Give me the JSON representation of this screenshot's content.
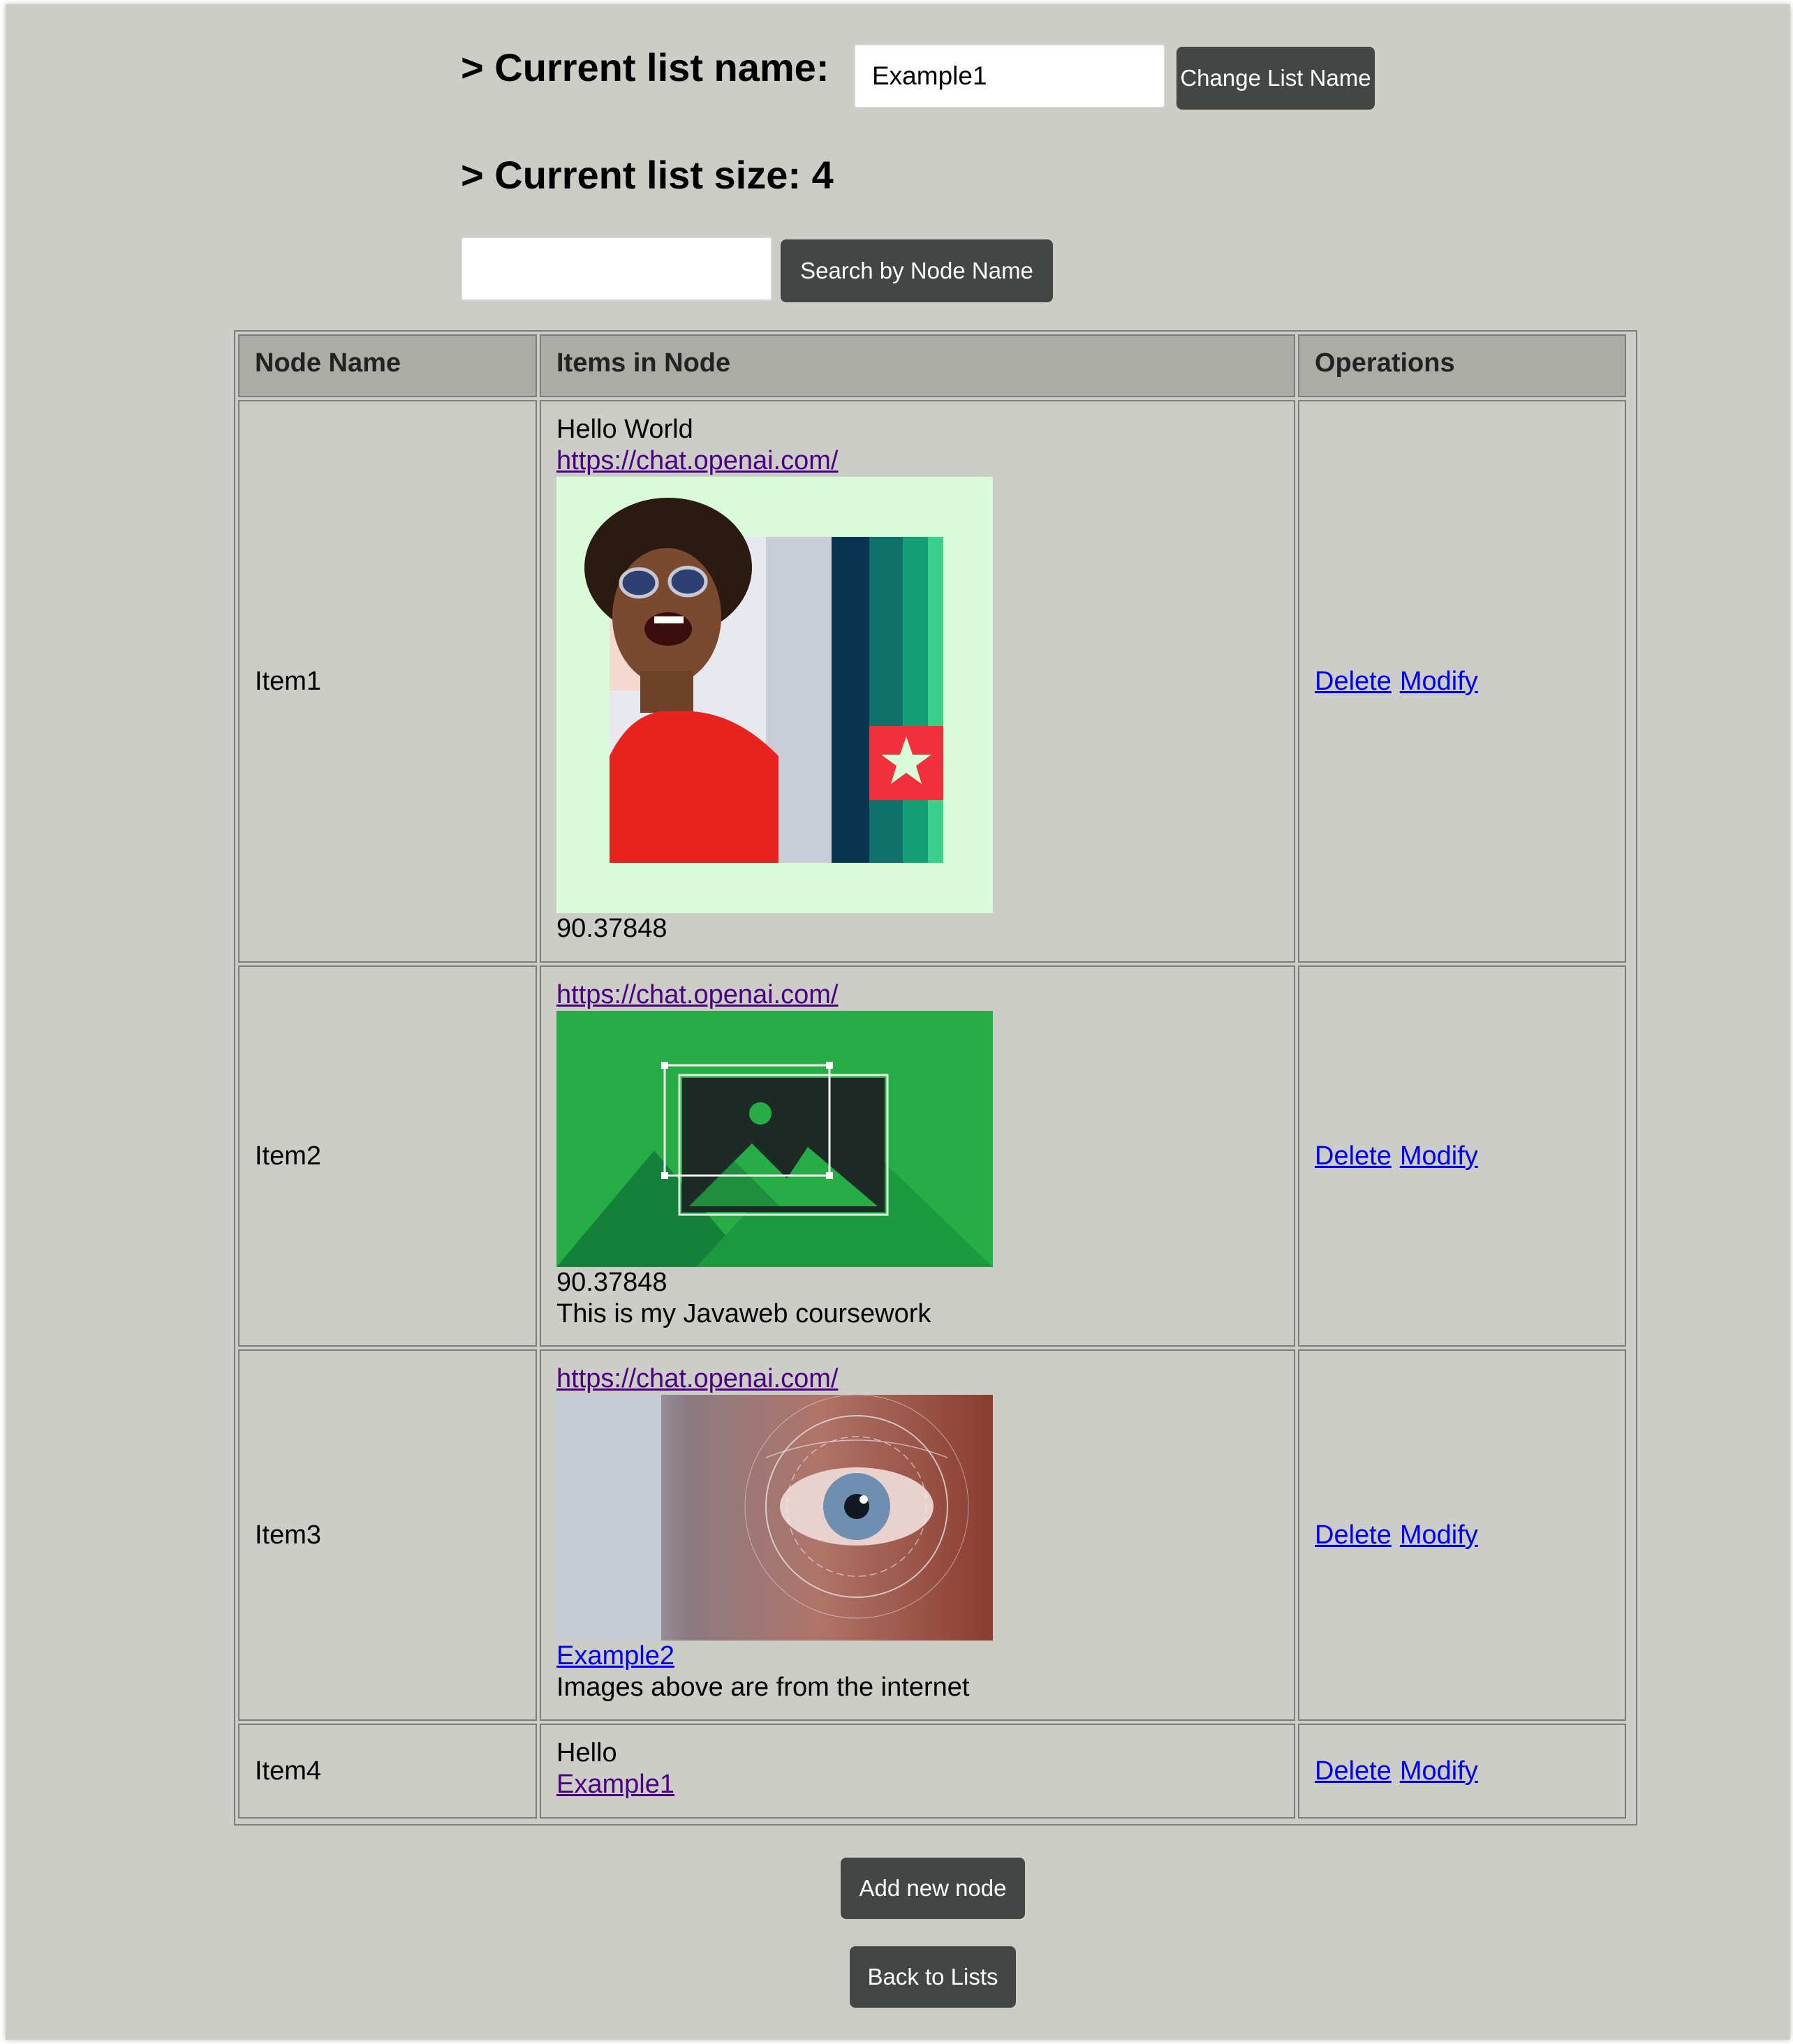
{
  "header": {
    "list_name_label": "> Current list name:",
    "list_name_value": "Example1",
    "change_name_button": "Change List Name",
    "list_size_label": "> Current list size: 4",
    "search_value": "",
    "search_button": "Search by Node Name"
  },
  "table": {
    "columns": [
      "Node Name",
      "Items in Node",
      "Operations"
    ],
    "rows": [
      {
        "name": "Item1",
        "items": [
          {
            "type": "text",
            "value": "Hello World"
          },
          {
            "type": "link",
            "value": "https://chat.openai.com/"
          },
          {
            "type": "image",
            "value": "portrait-banner-image"
          },
          {
            "type": "text",
            "value": "90.37848"
          }
        ]
      },
      {
        "name": "Item2",
        "items": [
          {
            "type": "link",
            "value": "https://chat.openai.com/"
          },
          {
            "type": "image",
            "value": "image-placeholder-icon"
          },
          {
            "type": "text",
            "value": "90.37848"
          },
          {
            "type": "text",
            "value": "This is my Javaweb coursework"
          }
        ]
      },
      {
        "name": "Item3",
        "items": [
          {
            "type": "link",
            "value": "https://chat.openai.com/"
          },
          {
            "type": "image",
            "value": "eye-scan-image"
          },
          {
            "type": "link",
            "value": "Example2"
          },
          {
            "type": "text",
            "value": "Images above are from the internet"
          }
        ]
      },
      {
        "name": "Item4",
        "items": [
          {
            "type": "text",
            "value": "Hello"
          },
          {
            "type": "link",
            "value": "Example1"
          }
        ]
      }
    ],
    "operations": {
      "delete": "Delete",
      "modify": "Modify"
    }
  },
  "footer": {
    "add_node_button": "Add new node",
    "back_button": "Back to Lists"
  },
  "colors": {
    "page_bg": "#cccdc7",
    "header_bg": "#abaca6",
    "button_bg": "#444545",
    "visited_link": "#4b0082",
    "link": "#0000ee"
  }
}
